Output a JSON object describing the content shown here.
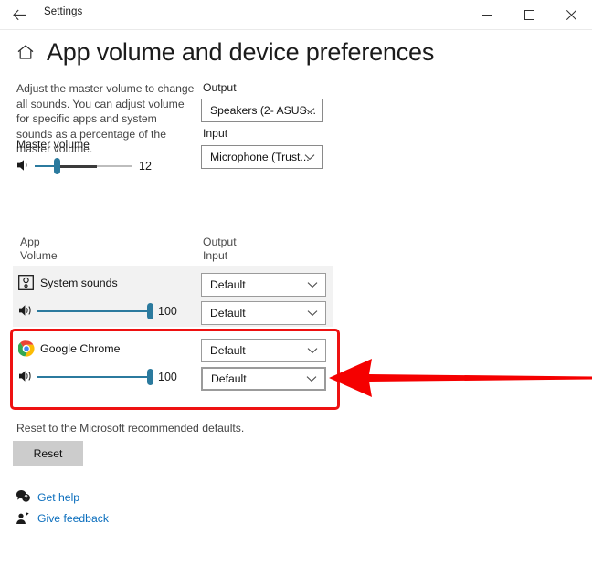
{
  "window": {
    "title": "Settings",
    "back_icon": "back-arrow-icon",
    "minimize_label": "–",
    "maximize_label": "□",
    "close_label": "×"
  },
  "header": {
    "home_icon": "home-icon",
    "title": "App volume and device preferences"
  },
  "intro": {
    "text": "Adjust the master volume to change all sounds. You can adjust volume for specific apps and system sounds as a percentage of the master volume."
  },
  "master": {
    "label": "Master volume",
    "speaker_icon": "speaker-icon",
    "value": "12",
    "percent": 22
  },
  "devices": {
    "output_label": "Output",
    "output_value": "Speakers (2- ASUS...",
    "input_label": "Input",
    "input_value": "Microphone (Trust..."
  },
  "columns": {
    "app": "App",
    "volume": "Volume",
    "output": "Output",
    "input": "Input"
  },
  "apps": [
    {
      "name": "System sounds",
      "icon": "system-sounds-icon",
      "volume_icon": "volume-icon",
      "volume_value": "100",
      "volume_percent": 100,
      "output_value": "Default",
      "input_value": "Default"
    },
    {
      "name": "Google Chrome",
      "icon": "google-chrome-icon",
      "volume_icon": "volume-icon",
      "volume_value": "100",
      "volume_percent": 100,
      "output_value": "Default",
      "input_value": "Default"
    }
  ],
  "reset": {
    "description": "Reset to the Microsoft recommended defaults.",
    "button_label": "Reset"
  },
  "footer": {
    "help_icon": "help-icon",
    "help_label": "Get help",
    "feedback_icon": "feedback-icon",
    "feedback_label": "Give feedback"
  },
  "annotation": {
    "highlight_color": "#ee1111",
    "arrow_icon": "left-arrow-annotation"
  }
}
